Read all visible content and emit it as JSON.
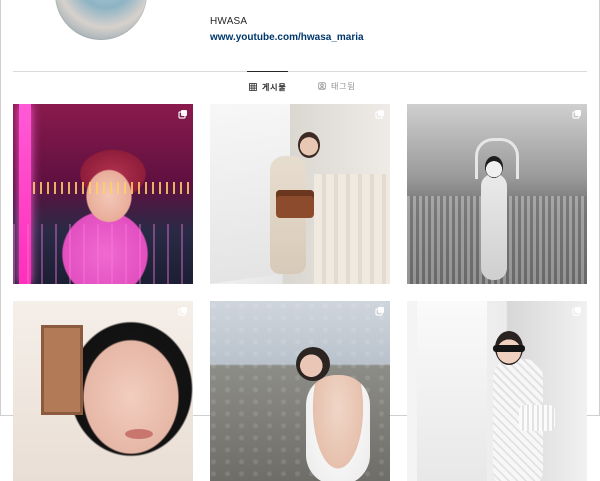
{
  "profile": {
    "username": "HWASA",
    "link_text": "www.youtube.com/hwasa_maria"
  },
  "tabs": [
    {
      "label": "게시물",
      "icon": "grid-icon",
      "active": true
    },
    {
      "label": "태그됨",
      "icon": "tag-icon",
      "active": false
    }
  ],
  "posts": [
    {
      "type": "multi-image",
      "icon": "multiple-posts-icon"
    },
    {
      "type": "multi-image",
      "icon": "multiple-posts-icon"
    },
    {
      "type": "multi-image",
      "icon": "multiple-posts-icon"
    },
    {
      "type": "multi-image",
      "icon": "multiple-posts-icon"
    },
    {
      "type": "multi-image",
      "icon": "multiple-posts-icon"
    },
    {
      "type": "multi-image",
      "icon": "multiple-posts-icon"
    }
  ],
  "colors": {
    "link": "#00376b",
    "tab_active": "#262626",
    "tab_inactive": "#8e8e8e",
    "divider": "#dbdbdb"
  }
}
